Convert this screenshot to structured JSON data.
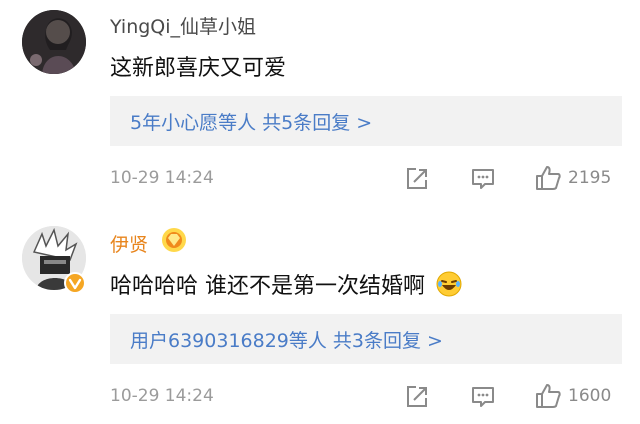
{
  "comments": [
    {
      "username": "YingQi_仙草小姐",
      "text": "这新郎喜庆又可爱",
      "replies_label": "5年小心愿等人  共5条回复 >",
      "time": "10-29 14:24",
      "likes": "2195"
    },
    {
      "username": "伊贤",
      "text": "哈哈哈哈 谁还不是第一次结婚啊",
      "replies_label": "用户6390316829等人  共3条回复 >",
      "time": "10-29 14:24",
      "likes": "1600"
    }
  ],
  "icons": {
    "share": "share-icon",
    "comment": "comment-icon",
    "like": "thumbs-up-icon",
    "verified": "verified-badge-icon",
    "member": "member-badge-icon",
    "laugh": "laughing-emoji-icon"
  },
  "colors": {
    "link": "#4a7cc7",
    "username_member": "#e8851d",
    "reply_bg": "#f2f2f2",
    "meta": "#9b9b9b"
  }
}
